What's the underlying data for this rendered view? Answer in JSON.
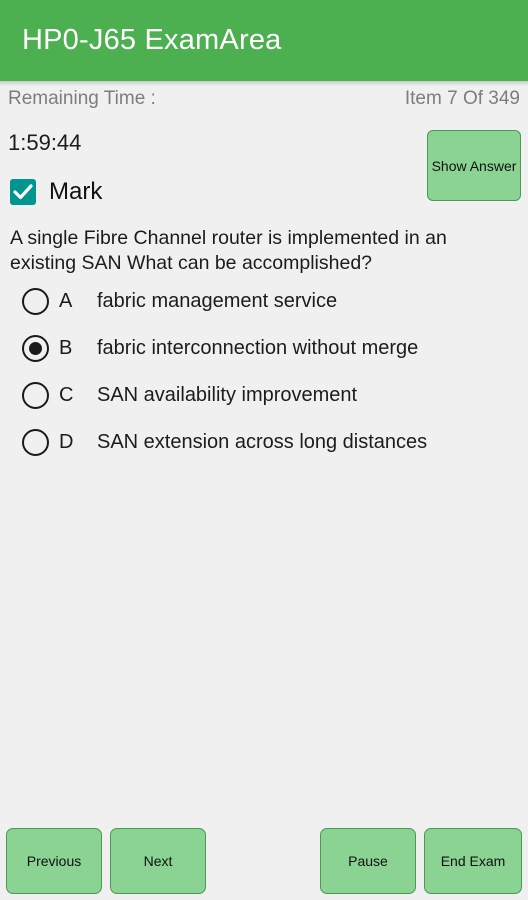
{
  "app": {
    "title": "HP0-J65 ExamArea",
    "header_color": "#4caf50",
    "background_color": "#f0f0f0",
    "button_color": "#8ad392",
    "checkbox_color": "#00968f"
  },
  "status": {
    "remaining_time_label": "Remaining Time :",
    "item_counter": "Item 7 Of 349",
    "timer_value": "1:59:44"
  },
  "actions": {
    "show_answer_label": "Show Answer"
  },
  "mark": {
    "label": "Mark",
    "checked": true,
    "check_icon": "check-icon"
  },
  "question": {
    "text": "A single Fibre Channel router is implemented in an existing SAN What can be accomplished?",
    "options": [
      {
        "letter": "A",
        "text": "fabric management service",
        "selected": false
      },
      {
        "letter": "B",
        "text": "fabric interconnection without merge",
        "selected": true
      },
      {
        "letter": "C",
        "text": "SAN availability improvement",
        "selected": false
      },
      {
        "letter": "D",
        "text": "SAN extension across long distances",
        "selected": false
      }
    ]
  },
  "bottom_bar": {
    "previous_label": "Previous",
    "next_label": "Next",
    "pause_label": "Pause",
    "end_exam_label": "End Exam"
  }
}
